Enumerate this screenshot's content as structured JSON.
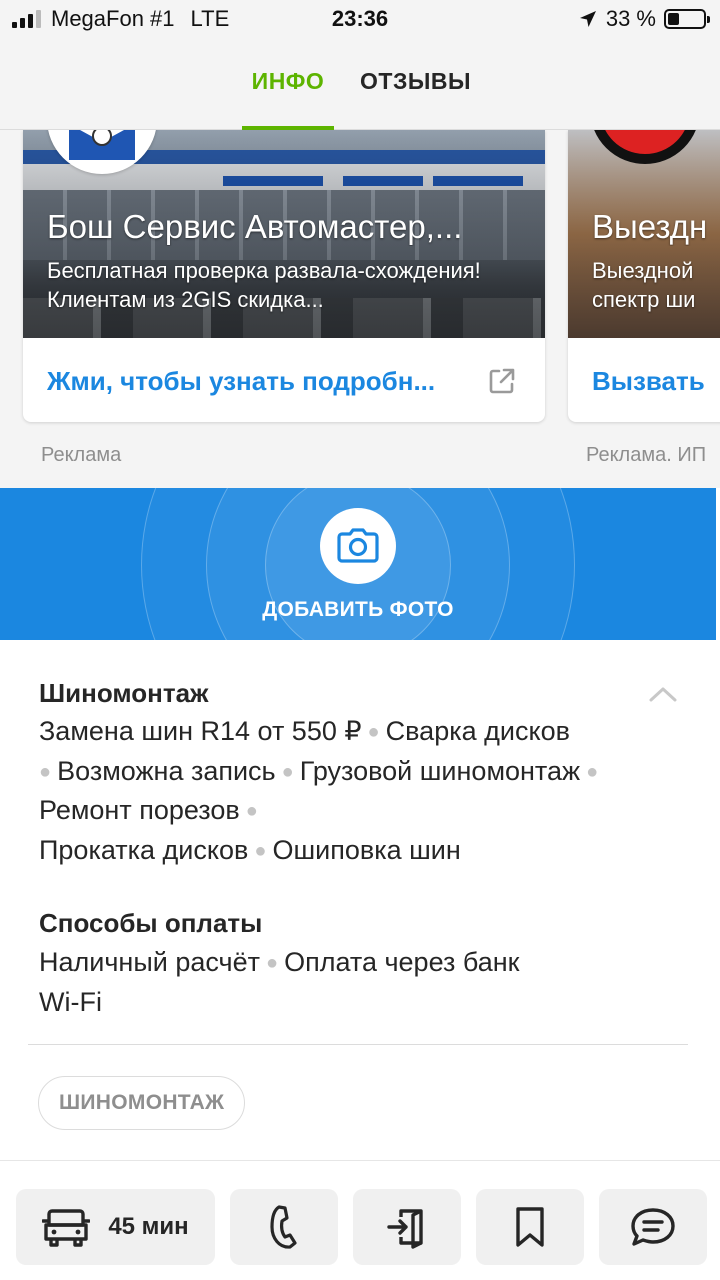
{
  "status_bar": {
    "carrier": "MegaFon #1",
    "network": "LTE",
    "time": "23:36",
    "battery_percent": "33 %",
    "battery_level": 0.33
  },
  "tabs": [
    {
      "label": "ИНФО",
      "active": true
    },
    {
      "label": "ОТЗЫВЫ",
      "active": false
    }
  ],
  "ads": [
    {
      "title": "Бош Сервис Автомастер,...",
      "description": "Бесплатная проверка развала-схождения! Клиентам из 2GIS скидка...",
      "cta": "Жми, чтобы узнать подробн...",
      "label": "Реклама"
    },
    {
      "title": "Выездн",
      "description_line1": "Выездной",
      "description_line2": "спектр ши",
      "cta": "Вызвать",
      "label": "Реклама. ИП"
    }
  ],
  "add_photo": {
    "label": "ДОБАВИТЬ ФОТО"
  },
  "services": {
    "title": "Шиномонтаж",
    "items": [
      "Замена шин R14 от 550 ₽",
      "Сварка дисков",
      "Возможна запись",
      "Грузовой шиномонтаж",
      "Ремонт порезов",
      "Прокатка дисков",
      "Ошиповка шин"
    ]
  },
  "payment": {
    "title": "Способы оплаты",
    "items": [
      "Наличный расчёт",
      "Оплата через банк"
    ],
    "extra": "Wi-Fi"
  },
  "rubric_chip": "ШИНОМОНТАЖ",
  "bottom_bar": {
    "route_time": "45 мин"
  },
  "colors": {
    "accent_green": "#5db400",
    "brand_blue": "#1b87e0",
    "muted_text": "#8e8e8e"
  },
  "icons": [
    "signal-icon",
    "location-arrow-icon",
    "battery-icon",
    "external-link-icon",
    "camera-icon",
    "chevron-up-icon",
    "car-icon",
    "phone-icon",
    "enter-icon",
    "bookmark-icon",
    "chat-icon"
  ]
}
